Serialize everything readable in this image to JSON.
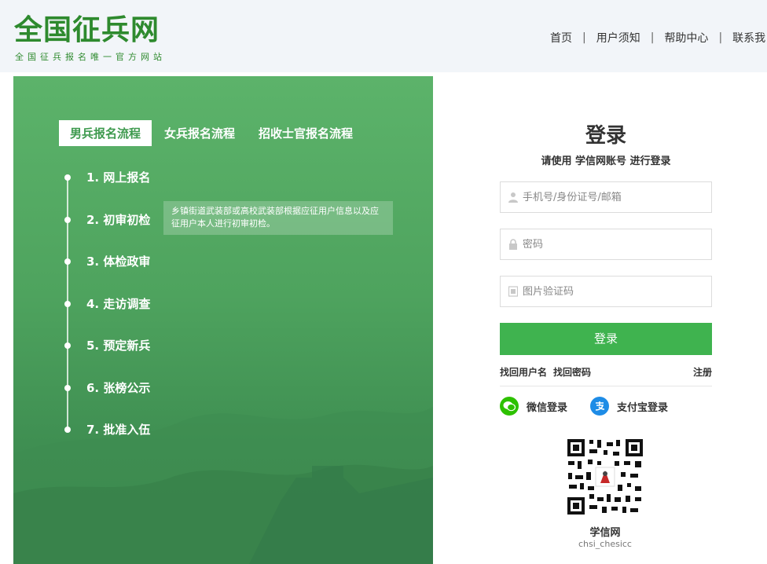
{
  "header": {
    "title": "全国征兵网",
    "subtitle": "全国征兵报名唯一官方网站",
    "nav": [
      "首页",
      "用户须知",
      "帮助中心",
      "联系我"
    ]
  },
  "process": {
    "tabs": [
      "男兵报名流程",
      "女兵报名流程",
      "招收士官报名流程"
    ],
    "active_tab": 0,
    "steps": [
      "1. 网上报名",
      "2. 初审初检",
      "3. 体检政审",
      "4. 走访调查",
      "5. 预定新兵",
      "6. 张榜公示",
      "7. 批准入伍"
    ],
    "tooltip": "乡镇街道武装部或高校武装部根据应征用户信息以及应征用户本人进行初审初检。"
  },
  "login": {
    "title": "登录",
    "subtitle": "请使用 学信网账号 进行登录",
    "username_placeholder": "手机号/身份证号/邮箱",
    "password_placeholder": "密码",
    "captcha_placeholder": "图片验证码",
    "button": "登录",
    "find_username": "找回用户名",
    "find_password": "找回密码",
    "register": "注册",
    "wechat_login": "微信登录",
    "alipay_login": "支付宝登录",
    "qr_name": "学信网",
    "qr_id": "chsi_chesicc"
  },
  "colors": {
    "brand_green": "#2e8a2e",
    "panel_green": "#4ea35e",
    "button_green": "#3fb34f",
    "wechat_green": "#2dc100",
    "alipay_blue": "#1e8ce6"
  }
}
